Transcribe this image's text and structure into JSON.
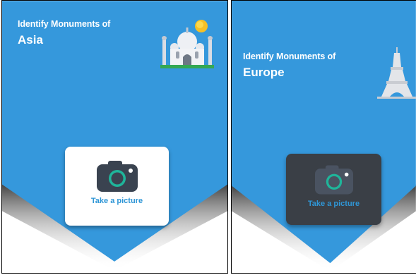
{
  "colors": {
    "primary_blue": "#3598dc",
    "camera_body": "#3a4350",
    "lens_ring": "#1fb59a",
    "label_blue": "#2f96d6",
    "dark_card": "#3a3f46"
  },
  "panels": [
    {
      "header_kicker": "Identify Monuments of",
      "region": "Asia",
      "monument_icon": "taj-mahal-icon",
      "action_label": "Take a picture",
      "action_icon": "camera-icon",
      "card_style": "light"
    },
    {
      "header_kicker": "Identify Monuments of",
      "region": "Europe",
      "monument_icon": "eiffel-tower-icon",
      "action_label": "Take a picture",
      "action_icon": "camera-icon",
      "card_style": "dark"
    }
  ]
}
